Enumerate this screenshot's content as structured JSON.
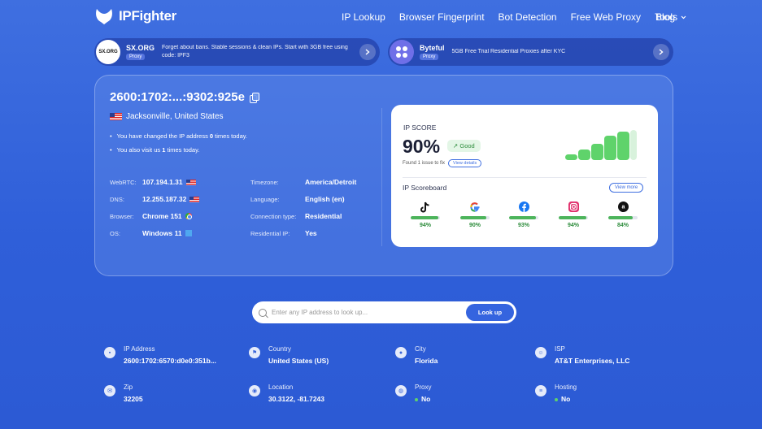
{
  "brand": {
    "name": "IPFighter"
  },
  "nav": {
    "links": [
      "IP Lookup",
      "Browser Fingerprint",
      "Bot Detection",
      "Free Web Proxy",
      "Tools",
      "Blog"
    ]
  },
  "promos": [
    {
      "logo": "SX.ORG",
      "name": "SX.ORG",
      "badge": "Proxy",
      "text": "Forget about bans. Stable sessions & clean IPs. Start with 3GB free using code: IPF3"
    },
    {
      "logo": "",
      "name": "Byteful",
      "badge": "Proxy",
      "text": "5GB Free Trial Residential Proxies after KYC"
    }
  ],
  "ip": {
    "address": "2600:1702:...:9302:925e",
    "location": "Jacksonville, United States",
    "notes": {
      "changed_pre": "You have changed the IP address ",
      "changed_count": "0",
      "changed_post": " times today.",
      "visit_pre": "You also visit us ",
      "visit_count": "1",
      "visit_post": " times today."
    },
    "left_info": [
      {
        "label": "WebRTC:",
        "value": "107.194.1.31"
      },
      {
        "label": "DNS:",
        "value": "12.255.187.32"
      },
      {
        "label": "Browser:",
        "value": "Chrome 151"
      },
      {
        "label": "OS:",
        "value": "Windows 11"
      }
    ],
    "right_info": [
      {
        "label": "Timezone:",
        "value": "America/Detroit"
      },
      {
        "label": "Language:",
        "value": "English (en)"
      },
      {
        "label": "Connection type:",
        "value": "Residential"
      },
      {
        "label": "Residential IP:",
        "value": "Yes"
      }
    ]
  },
  "score": {
    "label": "IP SCORE",
    "value": "90%",
    "badge": "↗ Good",
    "issue_text": "Found 1 issue to fix",
    "view_details": "View details",
    "bar_levels": [
      0.2,
      0.35,
      0.55,
      0.8,
      0.95,
      1.0
    ],
    "scoreboard_label": "IP Scoreboard",
    "view_more": "View more",
    "sites": [
      {
        "name": "tiktok-icon",
        "pct": "94%",
        "level": 0.94
      },
      {
        "name": "google-icon",
        "pct": "90%",
        "level": 0.9
      },
      {
        "name": "facebook-icon",
        "pct": "93%",
        "level": 0.93
      },
      {
        "name": "instagram-icon",
        "pct": "94%",
        "level": 0.94
      },
      {
        "name": "amazon-icon",
        "pct": "84%",
        "level": 0.84
      }
    ]
  },
  "search": {
    "placeholder": "Enter any IP address to look up...",
    "button": "Look up"
  },
  "details": [
    {
      "label": "IP Address",
      "value": "2600:1702:6570:d0e0:351b..."
    },
    {
      "label": "Country",
      "value": "United States (US)"
    },
    {
      "label": "City",
      "value": "Florida"
    },
    {
      "label": "ISP",
      "value": "AT&T Enterprises, LLC"
    },
    {
      "label": "Zip",
      "value": "32205"
    },
    {
      "label": "Location",
      "value": "30.3122, -81.7243"
    },
    {
      "label": "Proxy",
      "value": "No"
    },
    {
      "label": "Hosting",
      "value": "No"
    }
  ],
  "colors": {
    "accent": "#3564df",
    "good": "#5fd36b"
  }
}
